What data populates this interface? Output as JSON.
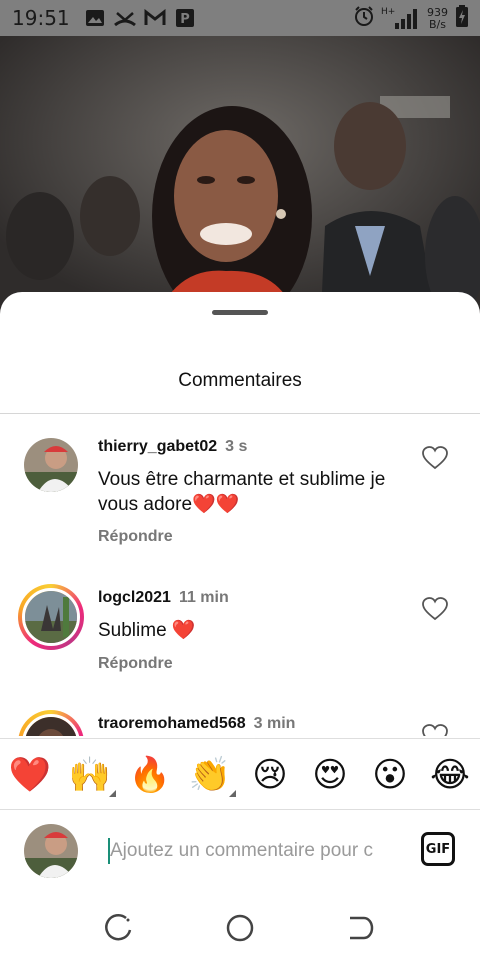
{
  "status_bar": {
    "time": "19:51",
    "network_type": "H+",
    "net_speed_value": "939",
    "net_speed_unit": "B/s",
    "icons": [
      "image-icon",
      "missed-call-icon",
      "gmail-icon",
      "powerpoint-icon",
      "alarm-icon",
      "signal-icon",
      "battery-icon"
    ]
  },
  "sheet": {
    "title": "Commentaires"
  },
  "comments": [
    {
      "username": "thierry_gabet02",
      "time": "3 s",
      "text": "Vous être charmante et sublime je vous adore❤️❤️",
      "reply_label": "Répondre",
      "has_story_ring": false
    },
    {
      "username": "logcl2021",
      "time": "11 min",
      "text": "Sublime ❤️",
      "reply_label": "Répondre",
      "has_story_ring": true
    },
    {
      "username": "traoremohamed568",
      "time": "3 min",
      "text": "",
      "reply_label": "",
      "has_story_ring": true
    }
  ],
  "reactions": [
    "❤️",
    "🙌",
    "🔥",
    "👏",
    "😢",
    "😍",
    "😮",
    "😂"
  ],
  "composer": {
    "placeholder": "Ajoutez un commentaire pour c",
    "gif_label": "GIF"
  },
  "colors": {
    "accent_caret": "#1a8f78",
    "like_heart_outline": "#555555",
    "story_ring": "#ee2a7b"
  }
}
